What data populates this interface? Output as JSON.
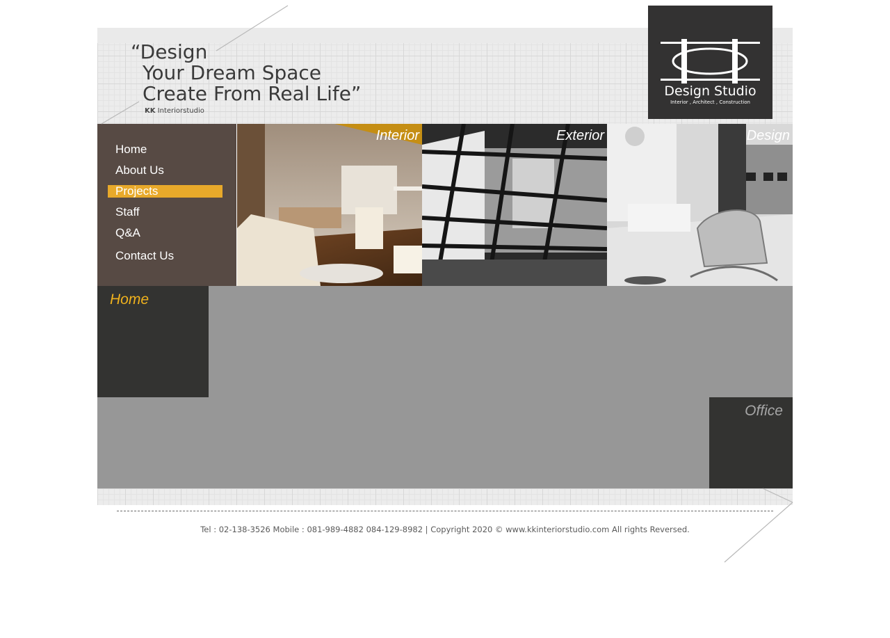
{
  "header": {
    "tagline_line1": "“Design",
    "tagline_line2": "Your Dream Space",
    "tagline_line3": "Create From Real Life”",
    "brand_bold": "KK",
    "brand_rest": " Interiorstudio"
  },
  "logo": {
    "name": "Design Studio",
    "subtitle": "Interior , Architect , Construction"
  },
  "nav": {
    "items": [
      {
        "label": "Home"
      },
      {
        "label": "About Us"
      },
      {
        "label": "Projects",
        "active": true
      },
      {
        "label": "Staff"
      },
      {
        "label": "Q&A"
      },
      {
        "label": "Contact Us"
      }
    ]
  },
  "banners": [
    {
      "caption": "Interior"
    },
    {
      "caption": "Exterior"
    },
    {
      "caption": "Design"
    }
  ],
  "sections": {
    "home_title": "Home",
    "office_title": "Office"
  },
  "footer": {
    "text": "Tel : 02-138-3526 Mobile : 081-989-4882 084-129-8982   |   Copyright 2020 © www.kkinteriorstudio.com All rights Reversed."
  },
  "colors": {
    "nav_bg": "#574a44",
    "active_highlight": "#e8a92a",
    "content_bg": "#979797",
    "dark_box": "#333331",
    "home_title": "#f0b21d"
  }
}
